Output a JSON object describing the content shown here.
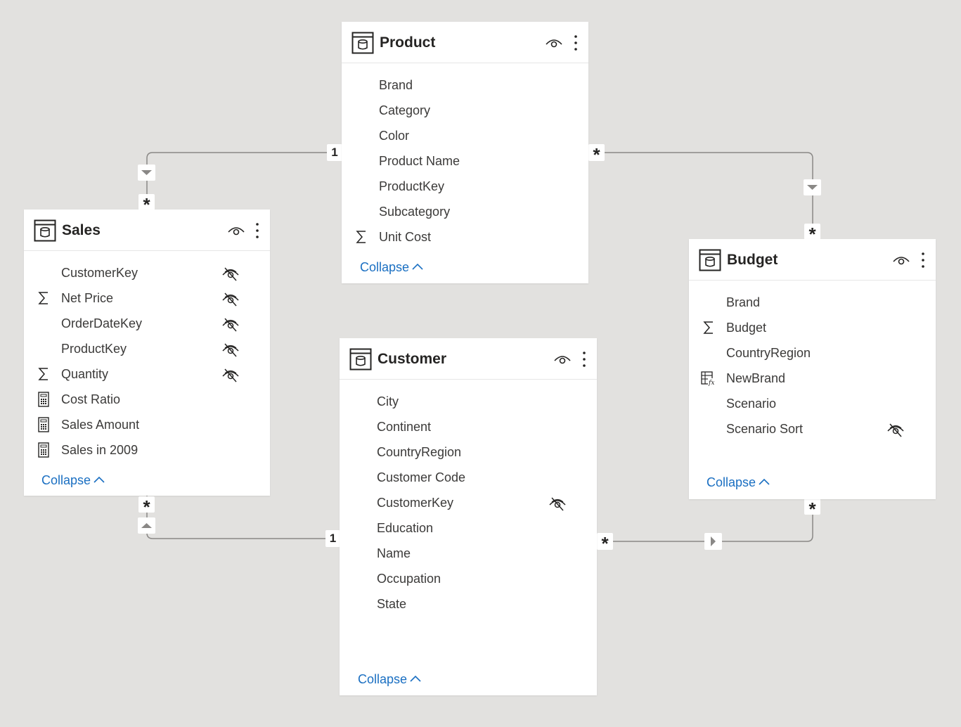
{
  "tables": {
    "product": {
      "title": "Product",
      "fields": [
        "Brand",
        "Category",
        "Color",
        "Product Name",
        "ProductKey",
        "Subcategory",
        "Unit Cost"
      ],
      "collapse": "Collapse"
    },
    "sales": {
      "title": "Sales",
      "fields": [
        "CustomerKey",
        "Net Price",
        "OrderDateKey",
        "ProductKey",
        "Quantity",
        "Cost Ratio",
        "Sales Amount",
        "Sales in 2009"
      ],
      "collapse": "Collapse"
    },
    "customer": {
      "title": "Customer",
      "fields": [
        "City",
        "Continent",
        "CountryRegion",
        "Customer Code",
        "CustomerKey",
        "Education",
        "Name",
        "Occupation",
        "State"
      ],
      "collapse": "Collapse"
    },
    "budget": {
      "title": "Budget",
      "fields": [
        "Brand",
        "Budget",
        "CountryRegion",
        "NewBrand",
        "Scenario",
        "Scenario Sort"
      ],
      "collapse": "Collapse"
    }
  },
  "relationships": {
    "product_sales": {
      "one": "1",
      "many": "*"
    },
    "product_budget": {
      "many_product": "*",
      "many_budget": "*"
    },
    "customer_sales": {
      "one": "1",
      "many": "*"
    },
    "customer_budget": {
      "many_customer": "*",
      "many_budget": "*"
    }
  }
}
